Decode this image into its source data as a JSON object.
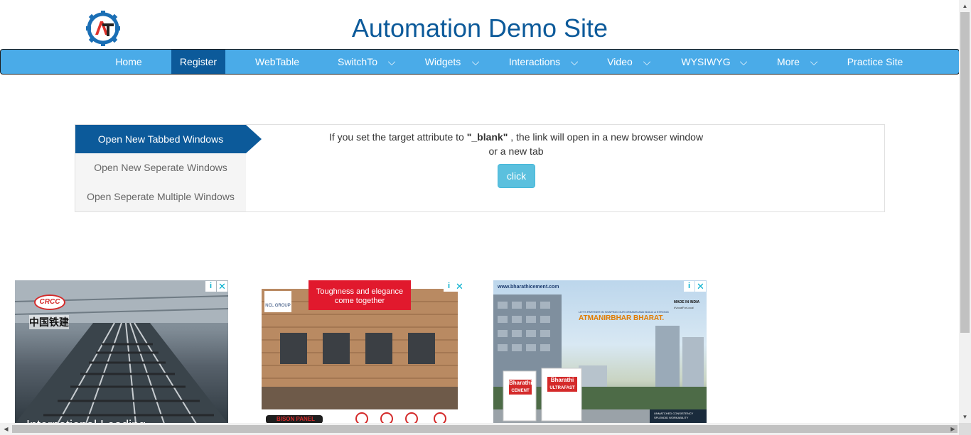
{
  "header": {
    "title": "Automation Demo Site"
  },
  "nav": {
    "items": [
      {
        "label": "Home",
        "has_dropdown": false,
        "active": false
      },
      {
        "label": "Register",
        "has_dropdown": false,
        "active": true
      },
      {
        "label": "WebTable",
        "has_dropdown": false,
        "active": false
      },
      {
        "label": "SwitchTo",
        "has_dropdown": true,
        "active": false
      },
      {
        "label": "Widgets",
        "has_dropdown": true,
        "active": false
      },
      {
        "label": "Interactions",
        "has_dropdown": true,
        "active": false
      },
      {
        "label": "Video",
        "has_dropdown": true,
        "active": false
      },
      {
        "label": "WYSIWYG",
        "has_dropdown": true,
        "active": false
      },
      {
        "label": "More",
        "has_dropdown": true,
        "active": false
      },
      {
        "label": "Practice Site",
        "has_dropdown": false,
        "active": false
      }
    ]
  },
  "windows": {
    "tabs": [
      {
        "label": "Open New Tabbed Windows",
        "active": true
      },
      {
        "label": "Open New Seperate Windows",
        "active": false
      },
      {
        "label": "Open Seperate Multiple Windows",
        "active": false
      }
    ],
    "description_part1": "If you set the target attribute to ",
    "description_bold": "\"_blank\"",
    "description_part2": " , the link will open in a new browser window",
    "description_line2": "or a new tab",
    "button_label": "click"
  },
  "ads": [
    {
      "text_logo": "CRCC",
      "text_chinese": "中国铁建",
      "caption": "International Leading..."
    },
    {
      "headline_line1": "Toughness and elegance",
      "headline_line2": "come together",
      "brand": "NCL GROUP",
      "footer_brand": "BISON PANEL"
    },
    {
      "url": "www.bharathicement.com",
      "tagline": "LET'S PARTNER IN SHAPING OUR DREAMS AND BUILD A STRONG",
      "slogan": "ATMANIRBHAR BHARAT.",
      "badge": "MADE IN INDIA",
      "badge_sub": "#VocalForLocal",
      "product1": "Bharathi",
      "product1_sub": "CEMENT",
      "product2": "Bharathi",
      "product2_sub": "ULTRAFAST",
      "footer_text": "UNMATCHED CONSISTENCY SPLENDID WORKABILITY"
    }
  ],
  "ad_controls": {
    "info_icon": "i",
    "close_icon": "✕"
  },
  "colors": {
    "brand": "#0c5a9a",
    "nav_bg": "#4aabe8",
    "button": "#5bc0de"
  }
}
